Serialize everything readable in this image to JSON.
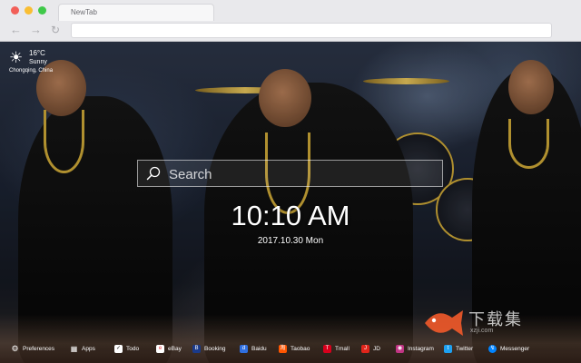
{
  "browser": {
    "tab_title": "NewTab",
    "back_icon": "arrow-left-icon",
    "forward_icon": "arrow-right-icon",
    "reload_icon": "reload-icon"
  },
  "weather": {
    "icon": "sun-icon",
    "temperature": "16°C",
    "condition": "Sunny",
    "city": "Chongqing, China"
  },
  "search": {
    "placeholder": "Search",
    "value": ""
  },
  "clock": {
    "time": "10:10 AM",
    "date": "2017.10.30 Mon"
  },
  "watermark": {
    "text": "下载集",
    "subtext": "xzji.com"
  },
  "bottom_bar": {
    "items": [
      {
        "label": "Preferences",
        "icon": "gear-icon",
        "color": "#ffffff"
      },
      {
        "label": "Apps",
        "icon": "apps-grid-icon",
        "color": "#ffffff"
      },
      {
        "label": "Todo",
        "icon": "checkbox-icon",
        "color": "#ffffff"
      },
      {
        "label": "eBay",
        "icon": "ebay-icon",
        "color": "#ffffff"
      },
      {
        "label": "Booking",
        "icon": "booking-icon",
        "color": "#1a3a8a"
      },
      {
        "label": "Baidu",
        "icon": "baidu-icon",
        "color": "#2f6fe0"
      },
      {
        "label": "Taobao",
        "icon": "taobao-icon",
        "color": "#ff5500"
      },
      {
        "label": "Tmall",
        "icon": "tmall-icon",
        "color": "#d8001c"
      },
      {
        "label": "JD",
        "icon": "jd-icon",
        "color": "#e1251b"
      },
      {
        "label": "Instagram",
        "icon": "instagram-icon",
        "color": "#c13584"
      },
      {
        "label": "Twitter",
        "icon": "twitter-icon",
        "color": "#1da1f2"
      },
      {
        "label": "Messenger",
        "icon": "messenger-icon",
        "color": "#0084ff"
      }
    ]
  }
}
